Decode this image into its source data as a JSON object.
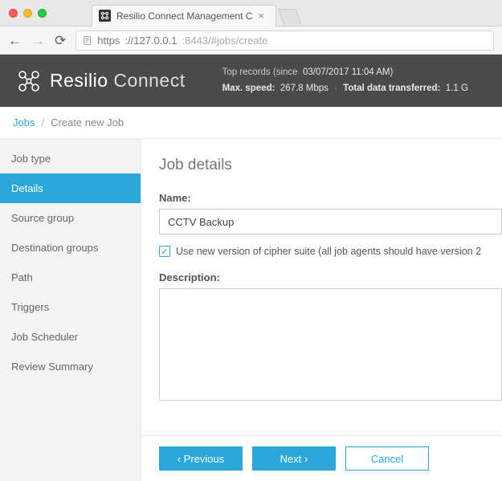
{
  "browser": {
    "tab_title": "Resilio Connect Management C",
    "url_https": "https",
    "url_host": "://127.0.0.1",
    "url_rest": ":8443/#jobs/create"
  },
  "brand": {
    "part1": "Resilio",
    "part2": "Connect"
  },
  "header_stats": {
    "line1_label": "Top records (since",
    "line1_value": "03/07/2017 11:04 AM)",
    "line2_label_speed": "Max. speed:",
    "line2_value_speed": "267.8 Mbps",
    "line2_label_total": "Total data transferred:",
    "line2_value_total": "1.1 G"
  },
  "breadcrumb": {
    "root": "Jobs",
    "current": "Create new Job"
  },
  "sidebar": {
    "items": [
      {
        "label": "Job type"
      },
      {
        "label": "Details"
      },
      {
        "label": "Source group"
      },
      {
        "label": "Destination groups"
      },
      {
        "label": "Path"
      },
      {
        "label": "Triggers"
      },
      {
        "label": "Job Scheduler"
      },
      {
        "label": "Review Summary"
      }
    ]
  },
  "form": {
    "heading": "Job details",
    "name_label": "Name:",
    "name_value": "CCTV Backup",
    "cipher_checkbox_label": "Use new version of cipher suite (all job agents should have version 2",
    "cipher_checked": true,
    "description_label": "Description:",
    "description_value": ""
  },
  "buttons": {
    "previous": "‹ Previous",
    "next": "Next ›",
    "cancel": "Cancel"
  }
}
